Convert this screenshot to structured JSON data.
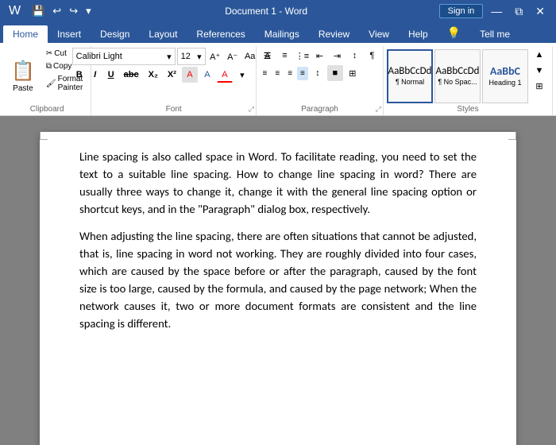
{
  "titleBar": {
    "title": "Document 1 - Word",
    "signinLabel": "Sign in",
    "quickAccess": [
      "↩",
      "↪",
      "▾"
    ]
  },
  "ribbonTabs": [
    {
      "id": "home",
      "label": "Home",
      "active": true
    },
    {
      "id": "insert",
      "label": "Insert",
      "active": false
    },
    {
      "id": "design",
      "label": "Design",
      "active": false
    },
    {
      "id": "layout",
      "label": "Layout",
      "active": false
    },
    {
      "id": "references",
      "label": "References",
      "active": false
    },
    {
      "id": "mailings",
      "label": "Mailings",
      "active": false
    },
    {
      "id": "review",
      "label": "Review",
      "active": false
    },
    {
      "id": "view",
      "label": "View",
      "active": false
    },
    {
      "id": "help",
      "label": "Help",
      "active": false
    },
    {
      "id": "lightbulb",
      "label": "💡",
      "active": false
    },
    {
      "id": "tellme",
      "label": "Tell me",
      "active": false
    }
  ],
  "clipboard": {
    "label": "Clipboard",
    "paste": "Paste",
    "cut": "Cut",
    "copy": "Copy",
    "formatPainter": "Format Painter"
  },
  "font": {
    "label": "Font",
    "name": "Calibri Light",
    "size": "12",
    "boldLabel": "B",
    "italicLabel": "I",
    "underlineLabel": "U",
    "strikethroughLabel": "abc",
    "subscriptLabel": "X₂",
    "superscriptLabel": "X²",
    "clearLabel": "A",
    "expandLabel": "⤢"
  },
  "paragraph": {
    "label": "Paragraph",
    "expandLabel": "⤢"
  },
  "styles": {
    "label": "Styles",
    "items": [
      {
        "id": "normal",
        "preview": "AaBbCcDd",
        "label": "¶ Normal",
        "active": true
      },
      {
        "id": "nospace",
        "preview": "AaBbCcDd",
        "label": "¶ No Spac..."
      },
      {
        "id": "heading1",
        "preview": "AaBbC",
        "label": "Heading 1"
      }
    ]
  },
  "document": {
    "paragraph1": "Line spacing is also called space in Word. To facilitate reading, you need to set the text to a suitable line spacing. How to change line spacing in word? There are usually three ways to change it, change it with the general line spacing option or shortcut keys, and in the \"Paragraph\" dialog box, respectively.",
    "paragraph2": "When adjusting the line spacing, there are often situations that cannot be adjusted, that is, line spacing in word not working. They are roughly divided into four cases, which are caused by the space before or after the paragraph, caused by the font size is too large, caused by the formula, and caused by the page network; When the network causes it, two or more document formats are consistent and the line spacing is different."
  }
}
